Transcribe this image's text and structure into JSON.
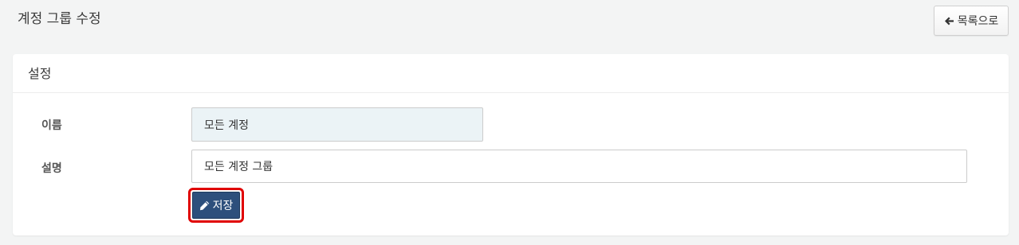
{
  "page": {
    "title": "계정 그룹 수정"
  },
  "toolbar": {
    "back_label": "목록으로",
    "back_icon": "arrow-left-icon"
  },
  "panel": {
    "heading": "설정"
  },
  "form": {
    "name_label": "이름",
    "name_value": "모든 계정",
    "desc_label": "설명",
    "desc_value": "모든 계정 그룹",
    "save_label": "저장",
    "save_icon": "pencil-icon"
  },
  "colors": {
    "background": "#f3f4f4",
    "save_button": "#2d4f7c",
    "highlight_border": "#e00000",
    "readonly_input": "#ebf3f6"
  }
}
